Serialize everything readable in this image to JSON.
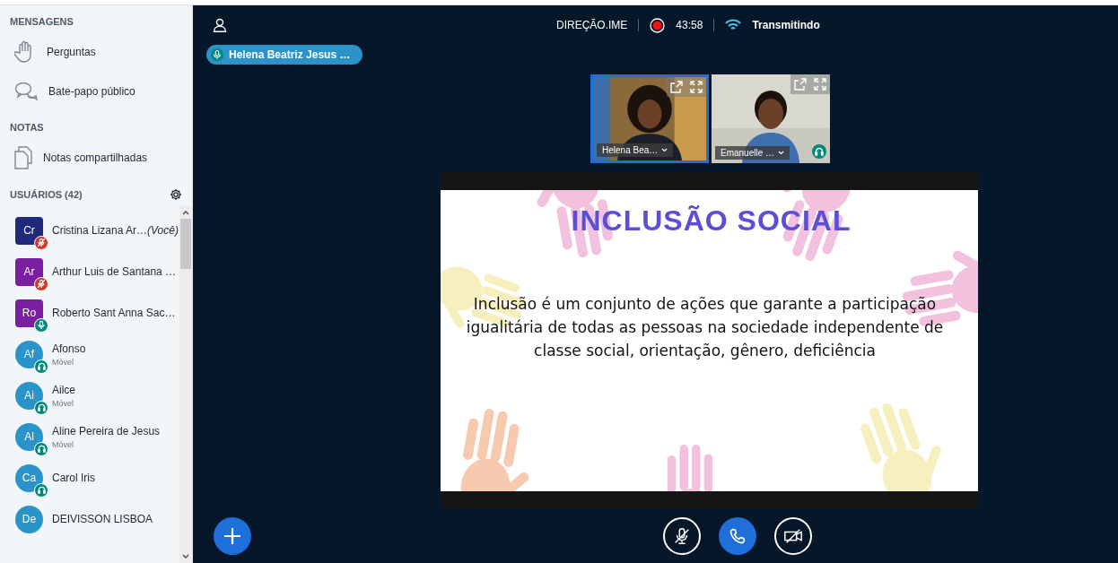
{
  "sidebar": {
    "sections": [
      {
        "title": "MENSAGENS",
        "items": [
          {
            "label": "Perguntas",
            "kind": "hand"
          },
          {
            "label": "Bate-papo público",
            "kind": "chat"
          }
        ]
      },
      {
        "title": "NOTAS",
        "items": [
          {
            "label": "Notas compartilhadas",
            "kind": "notes"
          }
        ]
      }
    ],
    "users_title": "USUÁRIOS (42)",
    "users": [
      {
        "initials": "Cr",
        "name": "Cristina Lizana Ar…",
        "suffix": "(Você)",
        "moderator": true,
        "color": "#1f2a7c",
        "kind": "muted"
      },
      {
        "initials": "Ar",
        "name": "Arthur Luis de Santana …",
        "moderator": true,
        "color": "#7b1fa2",
        "kind": "muted"
      },
      {
        "initials": "Ro",
        "name": "Roberto Sant Anna Sac…",
        "moderator": true,
        "color": "#7b1fa2",
        "kind": "talking"
      },
      {
        "initials": "Af",
        "name": "Afonso",
        "detail": "Móvel",
        "moderator": false,
        "color": "#2a93c9",
        "kind": "listening"
      },
      {
        "initials": "Ai",
        "name": "Ailce",
        "detail": "Móvel",
        "moderator": false,
        "color": "#2a93c9",
        "kind": "listening"
      },
      {
        "initials": "Al",
        "name": "Aline Pereira de Jesus",
        "detail": "Móvel",
        "moderator": false,
        "color": "#2a93c9",
        "kind": "listening"
      },
      {
        "initials": "Ca",
        "name": "Carol Iris",
        "moderator": false,
        "color": "#2a93c9",
        "kind": "listening"
      },
      {
        "initials": "De",
        "name": "DEIVISSON LISBOA",
        "moderator": false,
        "color": "#2a93c9",
        "kind": "plain"
      }
    ]
  },
  "header": {
    "session": "DIREÇÃO.IME",
    "recording": {
      "on": true,
      "time": "43:58"
    },
    "connection": "Transmitindo"
  },
  "presenter": "Helena Beatriz Jesus …",
  "videos": [
    {
      "name": "Helena Bea…",
      "selected": true,
      "listening": false
    },
    {
      "name": "Emanuelle …",
      "selected": false,
      "listening": true
    }
  ],
  "slide": {
    "title": "INCLUSÃO SOCIAL",
    "body": "Inclusão é um conjunto de ações que garante a participação igualitária de todas as pessoas na sociedade independente de classe social, orientação, gênero, deficiência"
  },
  "controls": [
    {
      "kind": "mic",
      "on": false
    },
    {
      "kind": "phone",
      "on": true
    },
    {
      "kind": "camera",
      "on": false
    }
  ]
}
